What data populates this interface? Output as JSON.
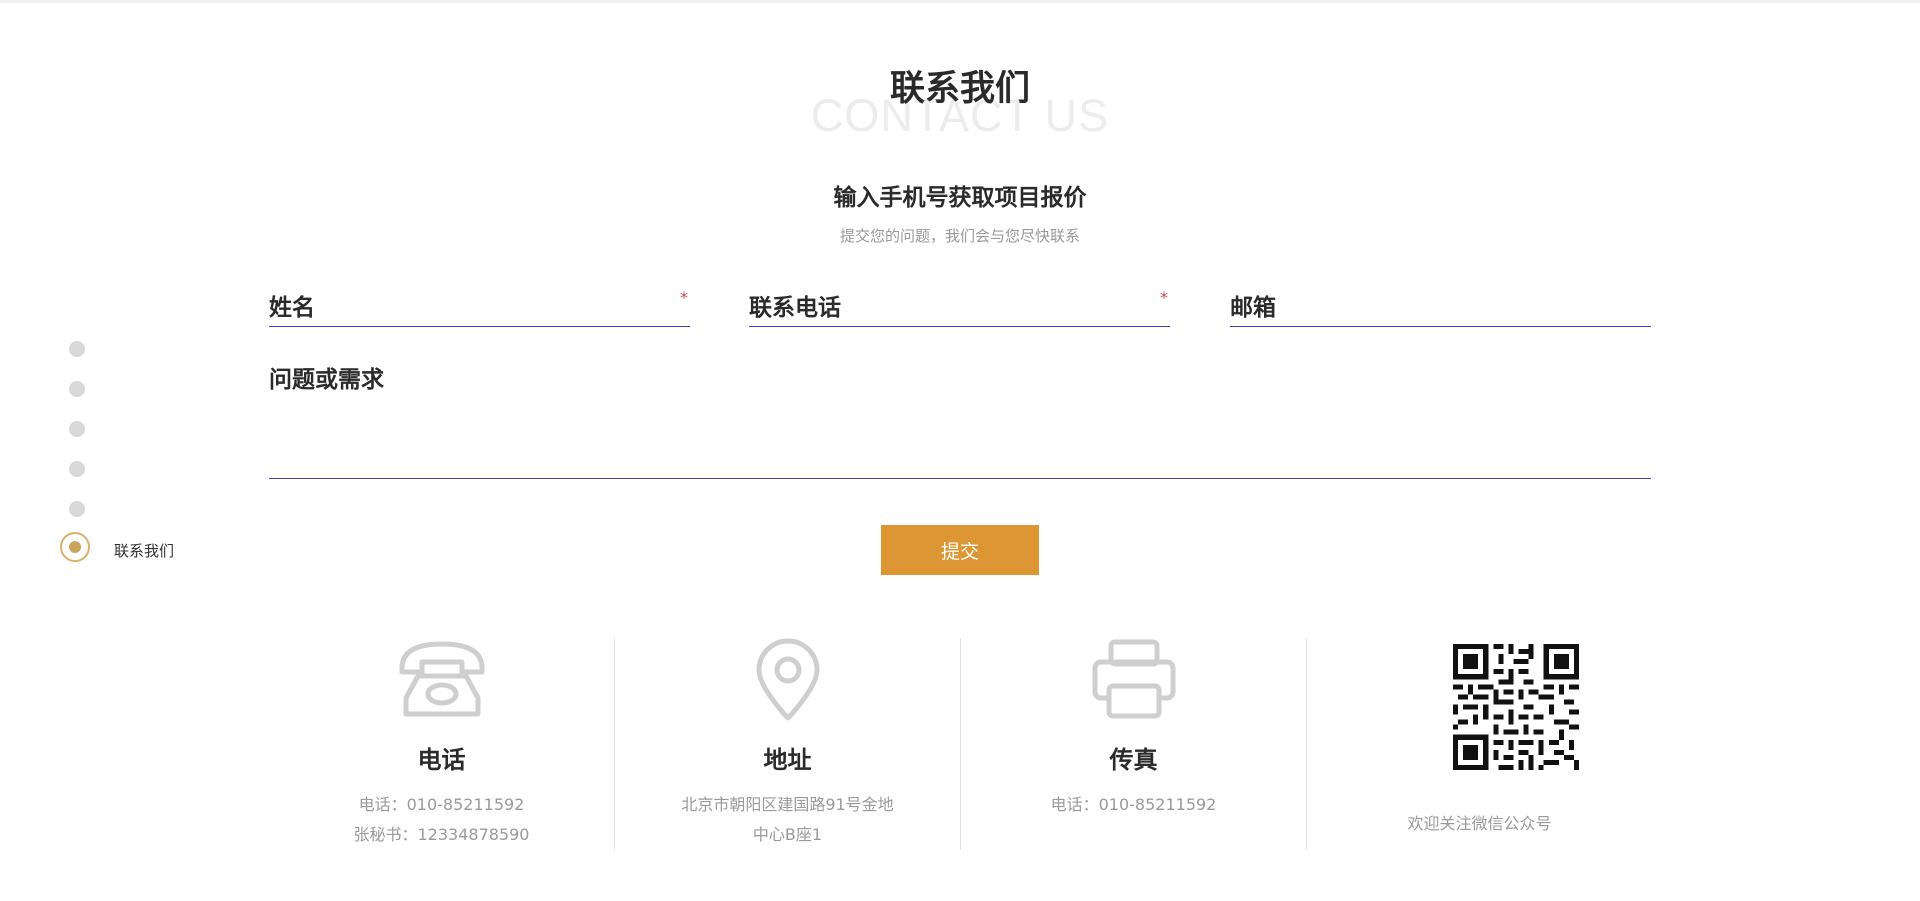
{
  "nav": {
    "active_label": "联系我们"
  },
  "heading": {
    "title": "联系我们",
    "title_en": "CONTACT US",
    "subtitle": "输入手机号获取项目报价",
    "description": "提交您的问题，我们会与您尽快联系"
  },
  "form": {
    "name_label": "姓名",
    "phone_label": "联系电话",
    "email_label": "邮箱",
    "message_label": "问题或需求",
    "required_mark": "*",
    "submit_label": "提交"
  },
  "cards": {
    "phone": {
      "title": "电话",
      "line1": "电话：010-85211592",
      "line2": "张秘书：12334878590"
    },
    "address": {
      "title": "地址",
      "line1": "北京市朝阳区建国路91号金地",
      "line2": "中心B座1"
    },
    "fax": {
      "title": "传真",
      "line1": "电话：010-85211592"
    },
    "wechat": {
      "caption": "欢迎关注微信公众号"
    }
  },
  "colors": {
    "accent": "#dc9634",
    "underline": "#4d3d9e",
    "required": "#c84a4a",
    "nav_active": "#c9a45e"
  }
}
